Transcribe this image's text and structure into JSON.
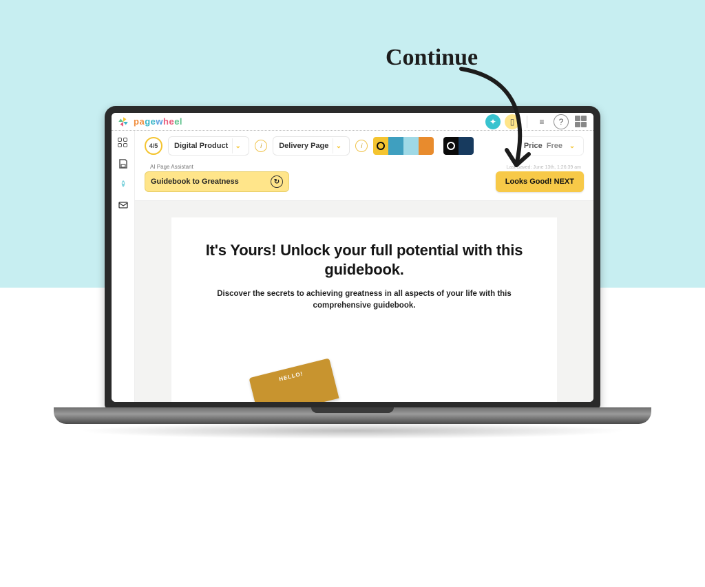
{
  "annotation": {
    "label": "Continue"
  },
  "brand": {
    "name": "pagewheel"
  },
  "topbar": {
    "icons": {
      "bolt": "⚡",
      "clipboard": "📋",
      "menu": "≡",
      "help": "?",
      "grid": "grid"
    }
  },
  "sidebar": {
    "items": [
      "dashboard",
      "save",
      "rocket",
      "mail"
    ]
  },
  "toolbar": {
    "step": "4/5",
    "product_type": "Digital Product",
    "page_type": "Delivery Page",
    "palette_a": [
      "#f4c430",
      "#3f9fbf",
      "#9fd9e6",
      "#e88b2d"
    ],
    "palette_b": [
      "#0b0b0b",
      "#173a5e"
    ],
    "price_label": "Price",
    "price_value": "Free"
  },
  "assistant": {
    "label": "AI Page Assistant",
    "title": "Guidebook to Greatness"
  },
  "next": {
    "last_saved": "Last Saved: June 13th, 1:26:39 am",
    "button": "Looks Good! NEXT"
  },
  "page": {
    "headline": "It's Yours! Unlock your full potential with this guidebook.",
    "subcopy": "Discover the secrets to achieving greatness in all aspects of your life with this comprehensive guidebook.",
    "book_badge": "HELLO!"
  }
}
